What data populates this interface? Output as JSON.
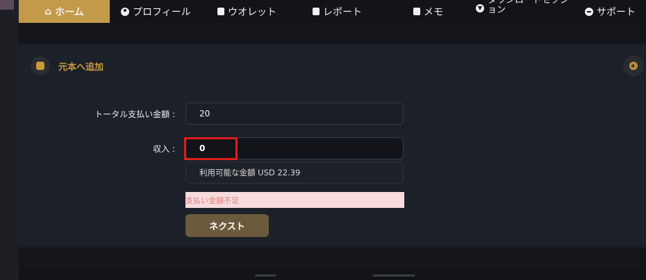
{
  "nav": {
    "home": "ホーム",
    "profile": "プロフィール",
    "wallet": "ウオレット",
    "report": "レポート",
    "memo": "メモ",
    "download": "ダウンロードセクション",
    "support": "サポート"
  },
  "card": {
    "title": "元本へ追加"
  },
  "form": {
    "total_label": "トータル支払い金額 :",
    "total_value": "20",
    "income_label": "収入 :",
    "income_value": "0",
    "available_text": "利用可能な金額 USD 22.39",
    "error_text": "支払い金額不足",
    "next_label": "ネクスト"
  },
  "colors": {
    "accent": "#c39a4a",
    "error_bg": "#f6dcdc",
    "error_text": "#df7f7f",
    "highlight": "#e01e1e"
  }
}
